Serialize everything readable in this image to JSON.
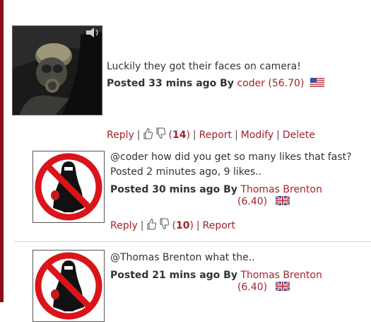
{
  "main_comment": {
    "avatar_icon": "gas-mask-photo",
    "text": "Luckily they got their faces on camera!",
    "posted_prefix": "Posted 33 mins ago By",
    "author": "coder",
    "karma": "(56.70)",
    "flag_icon": "us-flag-icon",
    "actions": {
      "reply": "Reply",
      "open_paren": "(",
      "likes": "14",
      "close_paren": ")",
      "report": "Report",
      "modify": "Modify",
      "delete": "Delete"
    }
  },
  "replies": [
    {
      "avatar_icon": "prohibited-burqa-sign",
      "text_line1": "@coder how did you get so many likes that fast?",
      "text_line2": "Posted 2 minutes ago, 9 likes..",
      "posted_prefix": "Posted 30 mins ago By",
      "author": "Thomas Brenton",
      "karma": "(6.40)",
      "flag_icon": "uk-flag-icon",
      "actions": {
        "reply": "Reply",
        "open_paren": "(",
        "likes": "10",
        "close_paren": ")",
        "report": "Report"
      }
    },
    {
      "avatar_icon": "prohibited-burqa-sign",
      "text_line1": "@Thomas Brenton what the..",
      "posted_prefix": "Posted 21 mins ago By",
      "author": "Thomas Brenton",
      "karma": "(6.40)",
      "flag_icon": "uk-flag-icon"
    }
  ],
  "colors": {
    "link": "#a4232a",
    "left_rule": "#8a0f14"
  }
}
